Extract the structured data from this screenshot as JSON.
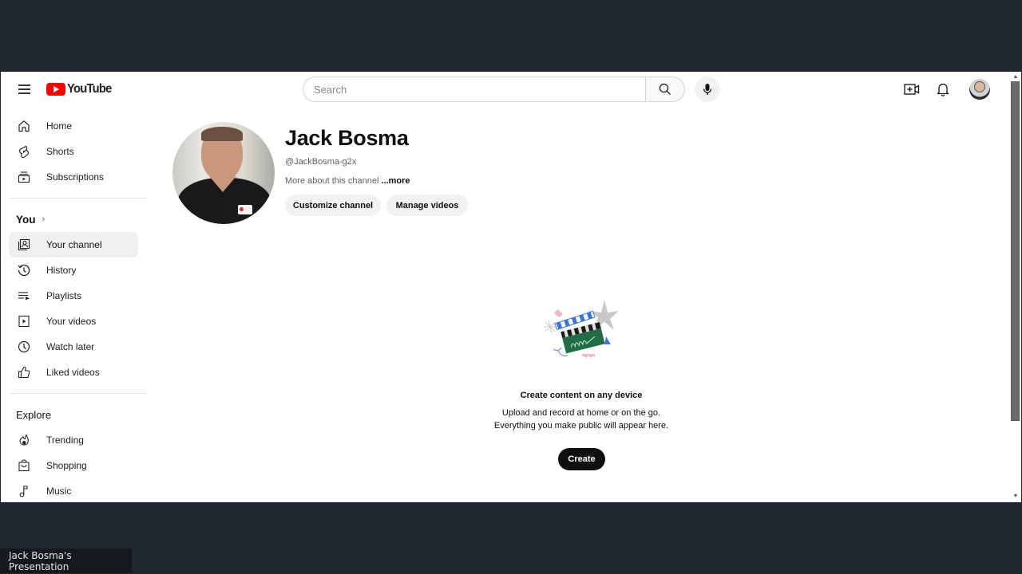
{
  "header": {
    "logo_text": "YouTube",
    "search_placeholder": "Search",
    "search_value": "",
    "icons": [
      "menu-icon",
      "search-icon",
      "microphone-icon",
      "create-video-icon",
      "notifications-bell-icon",
      "account-avatar"
    ]
  },
  "sidebar": {
    "main_items": [
      {
        "label": "Home",
        "icon": "home-icon"
      },
      {
        "label": "Shorts",
        "icon": "shorts-icon"
      },
      {
        "label": "Subscriptions",
        "icon": "subscriptions-icon"
      }
    ],
    "you_section": {
      "title": "You",
      "chevron": "›",
      "items": [
        {
          "label": "Your channel",
          "icon": "your-channel-icon",
          "active": true
        },
        {
          "label": "History",
          "icon": "history-icon"
        },
        {
          "label": "Playlists",
          "icon": "playlists-icon"
        },
        {
          "label": "Your videos",
          "icon": "your-videos-icon"
        },
        {
          "label": "Watch later",
          "icon": "watch-later-icon"
        },
        {
          "label": "Liked videos",
          "icon": "liked-videos-icon"
        }
      ]
    },
    "explore_section": {
      "title": "Explore",
      "items": [
        {
          "label": "Trending",
          "icon": "trending-icon"
        },
        {
          "label": "Shopping",
          "icon": "shopping-icon"
        },
        {
          "label": "Music",
          "icon": "music-icon"
        }
      ]
    }
  },
  "channel": {
    "name": "Jack Bosma",
    "handle": "@JackBosma-g2x",
    "description": "More about this channel ",
    "more_link": "...more",
    "buttons": {
      "customize": "Customize channel",
      "manage": "Manage videos"
    }
  },
  "empty_state": {
    "illustration": "clapperboard-illustration",
    "title": "Create content on any device",
    "line1": "Upload and record at home or on the go.",
    "line2": "Everything you make public will appear here.",
    "button": "Create"
  },
  "presentation_label": "Jack Bosma's Presentation",
  "colors": {
    "brand_red": "#ff0000",
    "background_dark": "#212730",
    "active_item_bg": "#f0f0f0",
    "primary_button": "#0f0f0f"
  }
}
